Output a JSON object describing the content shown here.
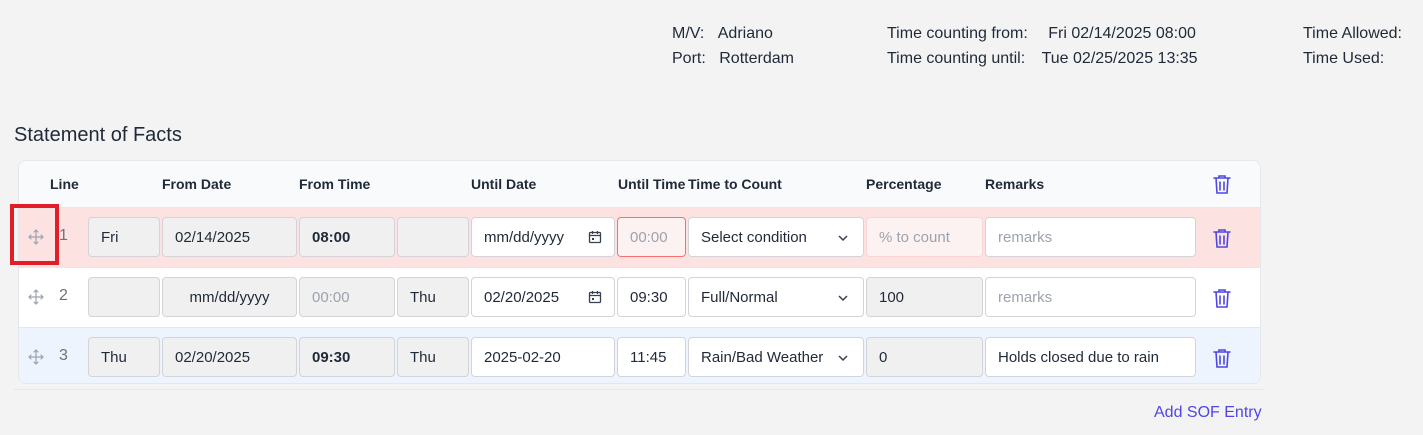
{
  "voyage": {
    "mv_label": "M/V:",
    "mv_value": "Adriano",
    "port_label": "Port:",
    "port_value": "Rotterdam",
    "from_label": "Time counting from:",
    "from_value": "Fri 02/14/2025 08:00",
    "until_label": "Time counting until:",
    "until_value": "Tue 02/25/2025 13:35",
    "allowed_label": "Time Allowed:",
    "used_label": "Time Used:"
  },
  "section_title": "Statement of Facts",
  "columns": {
    "line": "Line",
    "from_date": "From Date",
    "from_time": "From Time",
    "until_date": "Until Date",
    "until_time": "Until Time",
    "time_to_count": "Time to Count",
    "percentage": "Percentage",
    "remarks": "Remarks"
  },
  "rows": [
    {
      "line": "1",
      "from_day": "Fri",
      "from_date": "02/14/2025",
      "from_time": "08:00",
      "until_day": "",
      "until_date": "mm/dd/yyyy",
      "until_time": "00:00",
      "condition": "Select condition",
      "percentage": "% to count",
      "remarks": "remarks"
    },
    {
      "line": "2",
      "from_day": "",
      "from_date": "mm/dd/yyyy",
      "from_time": "00:00",
      "until_day": "Thu",
      "until_date": "02/20/2025",
      "until_time": "09:30",
      "condition": "Full/Normal",
      "percentage": "100",
      "remarks": "remarks"
    },
    {
      "line": "3",
      "from_day": "Thu",
      "from_date": "02/20/2025",
      "from_time": "09:30",
      "until_day": "Thu",
      "until_date": "2025-02-20",
      "until_time": "11:45",
      "condition": "Rain/Bad Weather",
      "percentage": "0",
      "remarks": "Holds closed due to rain"
    }
  ],
  "add_entry_label": "Add SOF Entry",
  "colors": {
    "accent": "#4f46e5",
    "error_row": "#fde2e2",
    "highlight_row": "#eef4fd",
    "highlight_box": "#e11d2a"
  },
  "icons": {
    "drag": "drag-move-icon",
    "delete": "trash-icon",
    "calendar": "calendar-icon",
    "dropdown": "chevron-down-icon"
  }
}
